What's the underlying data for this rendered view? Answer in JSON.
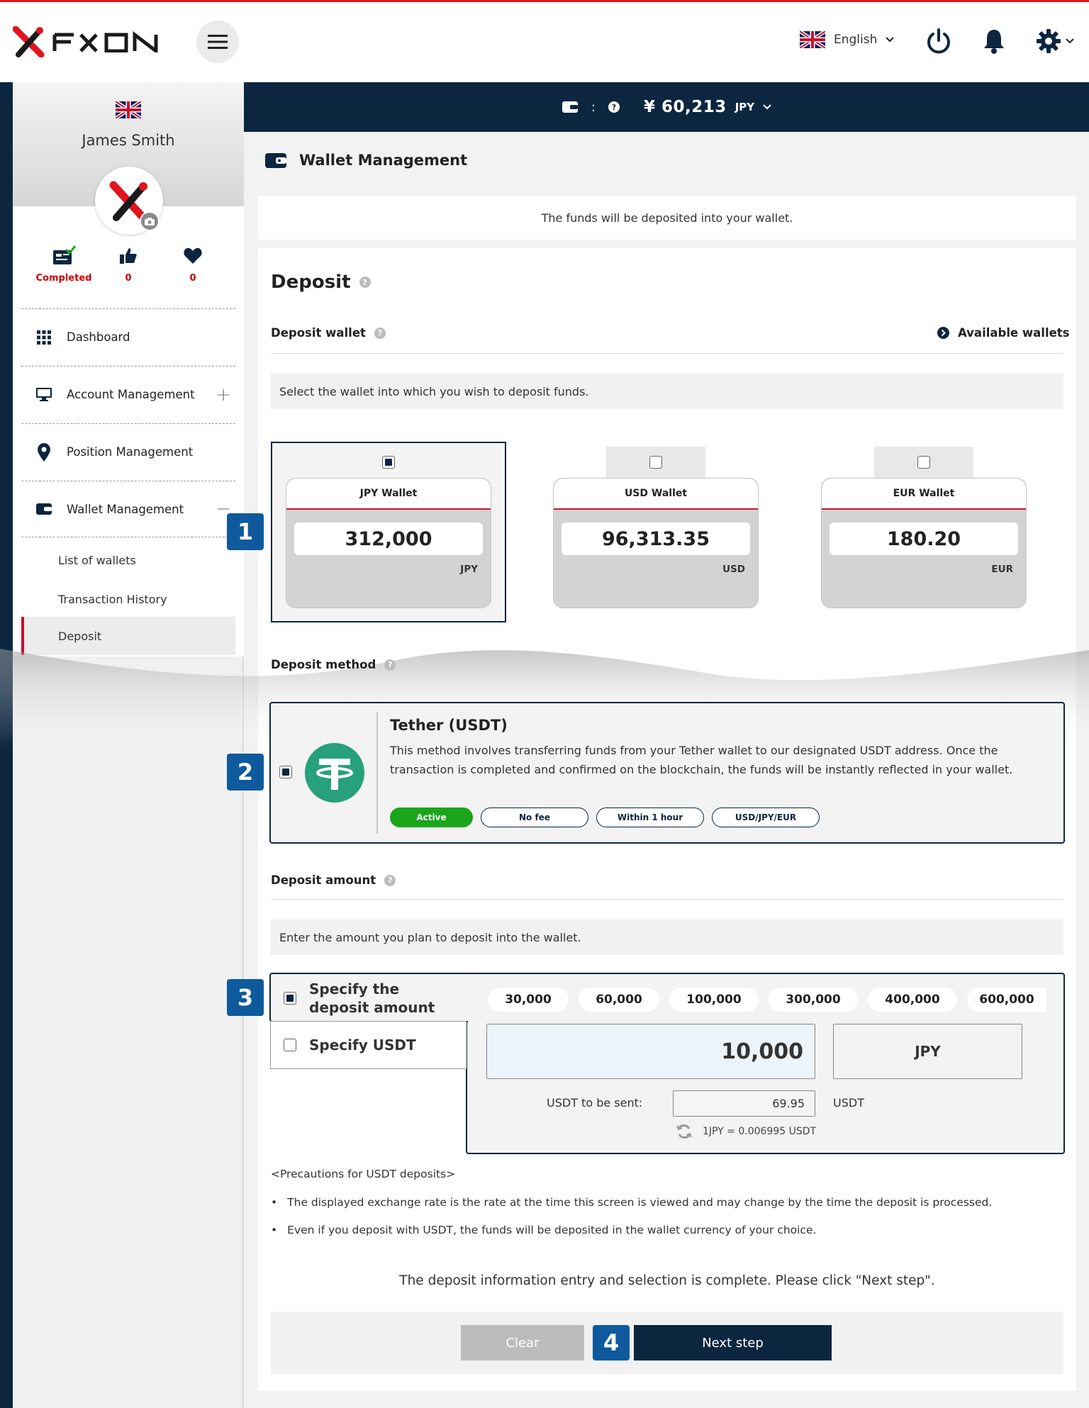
{
  "header": {
    "logo_text": "FXON",
    "language": "English",
    "icons": [
      "menu-icon",
      "uk-flag-icon",
      "power-icon",
      "bell-icon",
      "gear-icon"
    ]
  },
  "banner": {
    "separator": ":",
    "amount": "¥ 60,213",
    "currency": "JPY"
  },
  "sidebar": {
    "user_name": "James Smith",
    "stats": [
      {
        "label": "Completed",
        "icon": "id-card-check-icon"
      },
      {
        "label": "0",
        "icon": "thumbs-up-icon"
      },
      {
        "label": "0",
        "icon": "heart-icon"
      }
    ],
    "nav": [
      {
        "label": "Dashboard",
        "icon": "grid-icon"
      },
      {
        "label": "Account Management",
        "icon": "monitor-icon",
        "toggle": "+"
      },
      {
        "label": "Position Management",
        "icon": "map-pin-icon"
      },
      {
        "label": "Wallet Management",
        "icon": "wallet-icon",
        "toggle": "−"
      }
    ],
    "sub": [
      "List of wallets",
      "Transaction History",
      "Deposit"
    ]
  },
  "page": {
    "title": "Wallet Management",
    "info": "The funds will be deposited into your wallet.",
    "heading": "Deposit",
    "deposit_wallet_label": "Deposit wallet",
    "available_wallets": "Available wallets",
    "wallet_hint": "Select the wallet into which you wish to deposit funds.",
    "wallets": [
      {
        "name": "JPY Wallet",
        "value": "312,000",
        "currency": "JPY",
        "selected": true
      },
      {
        "name": "USD Wallet",
        "value": "96,313.35",
        "currency": "USD",
        "selected": false
      },
      {
        "name": "EUR Wallet",
        "value": "180.20",
        "currency": "EUR",
        "selected": false
      }
    ],
    "method_label": "Deposit method",
    "method": {
      "title": "Tether (USDT)",
      "desc1": "This method involves transferring funds from your Tether wallet to our designated USDT address. Once the",
      "desc2": "transaction is completed and confirmed on the blockchain, the funds will be instantly reflected in your wallet.",
      "badges": [
        "Active",
        "No fee",
        "Within 1 hour",
        "USD/JPY/EUR"
      ]
    },
    "amount_label": "Deposit amount",
    "amount_hint": "Enter the amount you plan to deposit into the wallet.",
    "opt_specify_line1": "Specify the",
    "opt_specify_line2": "deposit amount",
    "opt_usdt": "Specify USDT",
    "presets": [
      "30,000",
      "60,000",
      "100,000",
      "300,000",
      "400,000",
      "600,000"
    ],
    "amount_value": "10,000",
    "amount_currency": "JPY",
    "usdt_label": "USDT to be sent:",
    "usdt_value": "69.95",
    "usdt_unit": "USDT",
    "rate": "1JPY = 0.006995 USDT",
    "precautions_title": "<Precautions for USDT deposits>",
    "precaution1": "The displayed exchange rate is the rate at the time this screen is viewed and may change by the time the deposit is processed.",
    "precaution2": "Even if you deposit with USDT, the funds will be deposited in the wallet currency of your choice.",
    "complete_msg": "The deposit information entry and selection is complete. Please click \"Next step\".",
    "clear_btn": "Clear",
    "next_btn": "Next step"
  },
  "steps": [
    "1",
    "2",
    "3",
    "4"
  ],
  "colors": {
    "navy": "#0c2640",
    "accent_red": "#c8102e",
    "step_blue": "#0e5a9c",
    "active_green": "#1aa51a",
    "tether_green": "#26a17b"
  }
}
